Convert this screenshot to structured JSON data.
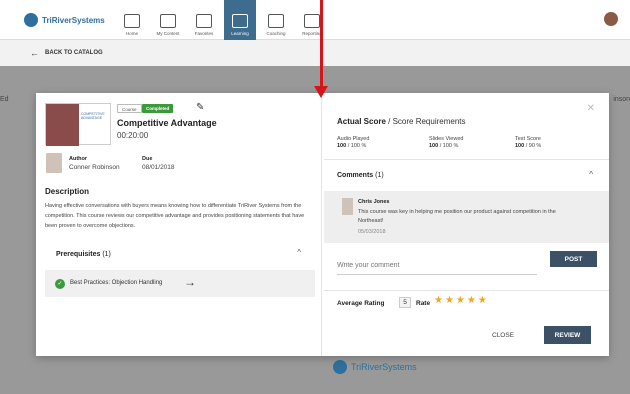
{
  "app": {
    "logo_text": "TriRiverSystems"
  },
  "nav": [
    {
      "label": "Home"
    },
    {
      "label": "My Content"
    },
    {
      "label": "Favorites"
    },
    {
      "label": "Learning"
    },
    {
      "label": "Coaching"
    },
    {
      "label": "Reporting"
    }
  ],
  "back_label": "BACK TO CATALOG",
  "background": {
    "left_fragment": "Ed",
    "right_fragment": "inson",
    "footer_logo": "TriRiverSystems"
  },
  "course": {
    "tag_course": "Course",
    "tag_status": "Completed",
    "title": "Competitive Advantage",
    "duration": "00:20:00",
    "thumb_text": "COMPETITIVE ADVANTAGE",
    "author_label": "Author",
    "author_name": "Conner Robinson",
    "due_label": "Due",
    "due_value": "08/01/2018",
    "description_heading": "Description",
    "description": "Having effective conversations with buyers means knowing how to differentiate TriRiver Systems from the competition. This course reviews our competitive advantage and provides positioning statements that have been proven to overcome objections."
  },
  "prerequisites": {
    "title": "Prerequisites",
    "count": "(1)",
    "items": [
      {
        "label": "Best Practices: Objection Handling"
      }
    ]
  },
  "score": {
    "heading_bold": "Actual Score",
    "heading_rest": " / Score Requirements",
    "columns": [
      {
        "label": "Audio Played",
        "actual": "100",
        "required": " / 100 %"
      },
      {
        "label": "Slides Viewed",
        "actual": "100",
        "required": " / 100 %"
      },
      {
        "label": "Test Score",
        "actual": "100",
        "required": " / 90 %"
      }
    ]
  },
  "comments": {
    "title": "Comments",
    "count": "(1)",
    "items": [
      {
        "author": "Chris Jones",
        "text": "This course was key in helping me position our product against competition in the Northeast!",
        "date": "05/03/2018"
      }
    ],
    "input_placeholder": "Write your comment",
    "post_label": "POST"
  },
  "rating": {
    "average_label": "Average Rating",
    "average_value": "5",
    "rate_label": "Rate",
    "stars": "★★★★★"
  },
  "actions": {
    "close_label": "CLOSE",
    "review_label": "REVIEW"
  },
  "colors": {
    "accent": "#3d5166",
    "status_green": "#3a9a3c",
    "star": "#f0a61d",
    "callout_red": "#d4161b"
  }
}
